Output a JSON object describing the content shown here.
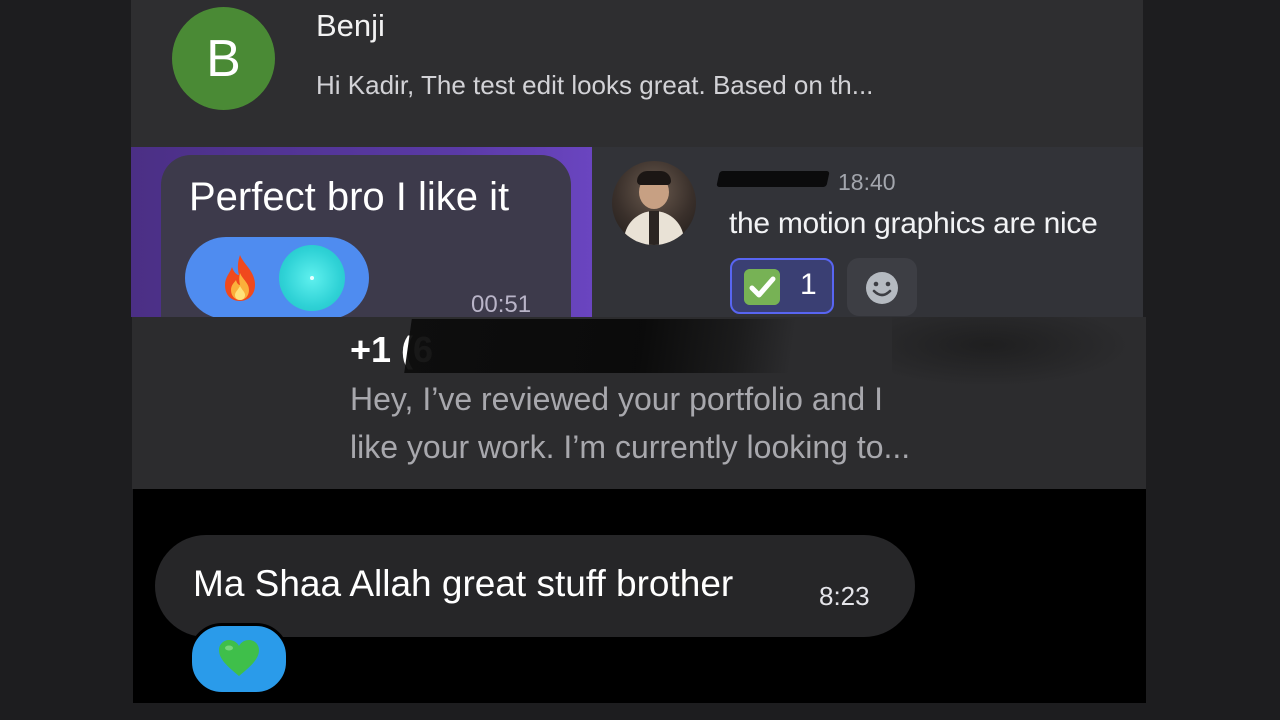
{
  "benji_notification": {
    "avatar_letter": "B",
    "name": "Benji",
    "preview": "Hi Kadir, The test edit looks great. Based on th..."
  },
  "purple_chat": {
    "message": "Perfect bro I like it",
    "time": "00:51",
    "reactions": [
      "fire-icon",
      "teal-circle-sticker"
    ]
  },
  "discord_message": {
    "time": "18:40",
    "message": "the motion graphics are nice",
    "reaction_count": "1",
    "reaction_icon": "check-mark-icon"
  },
  "phone_notification": {
    "sender_visible": "+1 (6",
    "preview_line1": "Hey, I’ve reviewed your portfolio and I",
    "preview_line2": "like your work. I’m currently looking to..."
  },
  "dark_chat": {
    "message": "Ma Shaa Allah great stuff brother",
    "time": "8:23",
    "reaction_icon": "green-heart-icon"
  },
  "colors": {
    "benji_avatar": "#4a8a35",
    "purple_bg": "#5a3aa6",
    "reaction_blue": "#4f8cf0",
    "discord_accent": "#5865f2",
    "heart_pill": "#2a9bea"
  }
}
